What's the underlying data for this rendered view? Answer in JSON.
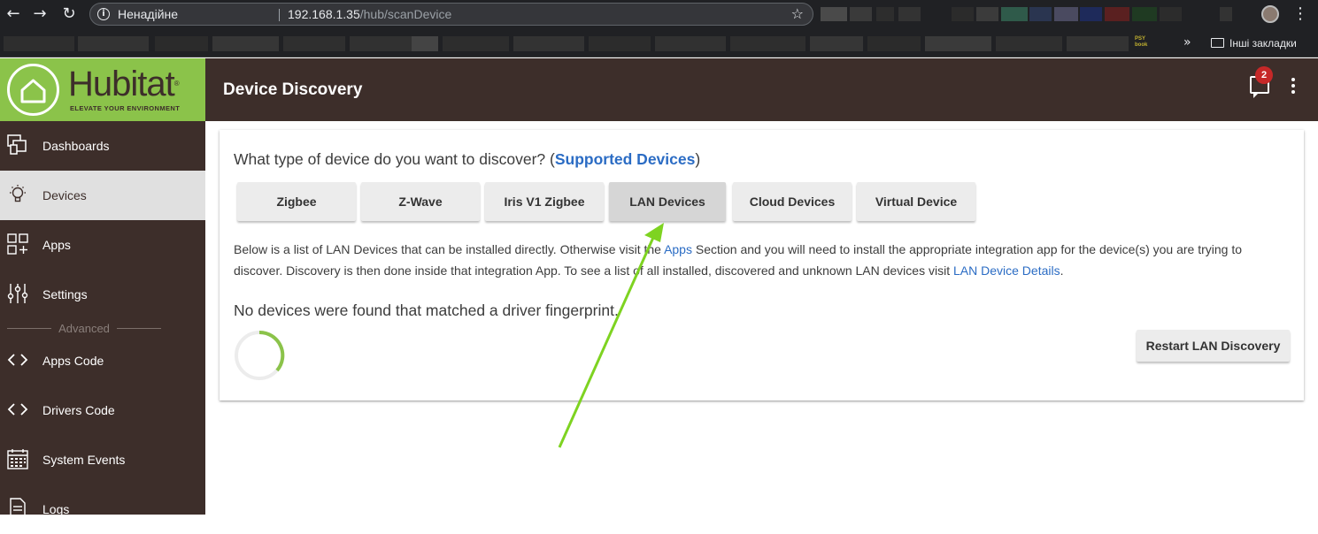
{
  "browser": {
    "security_label": "Ненадійне",
    "url_host": "192.168.1.35",
    "url_path": "/hub/scanDevice",
    "bookmark_psy": "PSY book",
    "other_bookmarks": "Інші закладки"
  },
  "header": {
    "title": "Device Discovery",
    "notification_count": "2"
  },
  "sidebar": {
    "logo_text": "Hubitat",
    "logo_tagline": "ELEVATE YOUR ENVIRONMENT",
    "advanced_label": "Advanced",
    "items": [
      {
        "label": "Dashboards",
        "icon": "dashboards-icon"
      },
      {
        "label": "Devices",
        "icon": "lightbulb-icon",
        "active": true
      },
      {
        "label": "Apps",
        "icon": "apps-grid-icon"
      },
      {
        "label": "Settings",
        "icon": "sliders-icon"
      },
      {
        "label": "Apps Code",
        "icon": "code-icon"
      },
      {
        "label": "Drivers Code",
        "icon": "code-icon"
      },
      {
        "label": "System Events",
        "icon": "calendar-icon"
      },
      {
        "label": "Logs",
        "icon": "document-icon"
      }
    ]
  },
  "main": {
    "question_prefix": "What type of device do you want to discover? (",
    "question_link": "Supported Devices",
    "question_suffix": ")",
    "type_buttons": [
      {
        "label": "Zigbee"
      },
      {
        "label": "Z-Wave"
      },
      {
        "label": "Iris V1 Zigbee"
      },
      {
        "label": "LAN Devices",
        "active": true
      },
      {
        "label": "Cloud Devices"
      },
      {
        "label": "Virtual Device"
      }
    ],
    "desc_1": "Below is a list of LAN Devices that can be installed directly. Otherwise visit the ",
    "desc_apps_link": "Apps",
    "desc_2": " Section and you will need to install the appropriate integration app for the device(s) you are trying to discover. Discovery is then done inside that integration App. To see a list of all installed, discovered and unknown LAN devices visit ",
    "desc_details_link": "LAN Device Details",
    "desc_3": ".",
    "no_devices_text": "No devices were found that matched a driver fingerprint.",
    "restart_button": "Restart LAN Discovery"
  },
  "colors": {
    "brand_green": "#8bc34a",
    "header_brown": "#3d2e2a",
    "link_blue": "#2b6cc4",
    "annotation_arrow": "#7ed321"
  }
}
